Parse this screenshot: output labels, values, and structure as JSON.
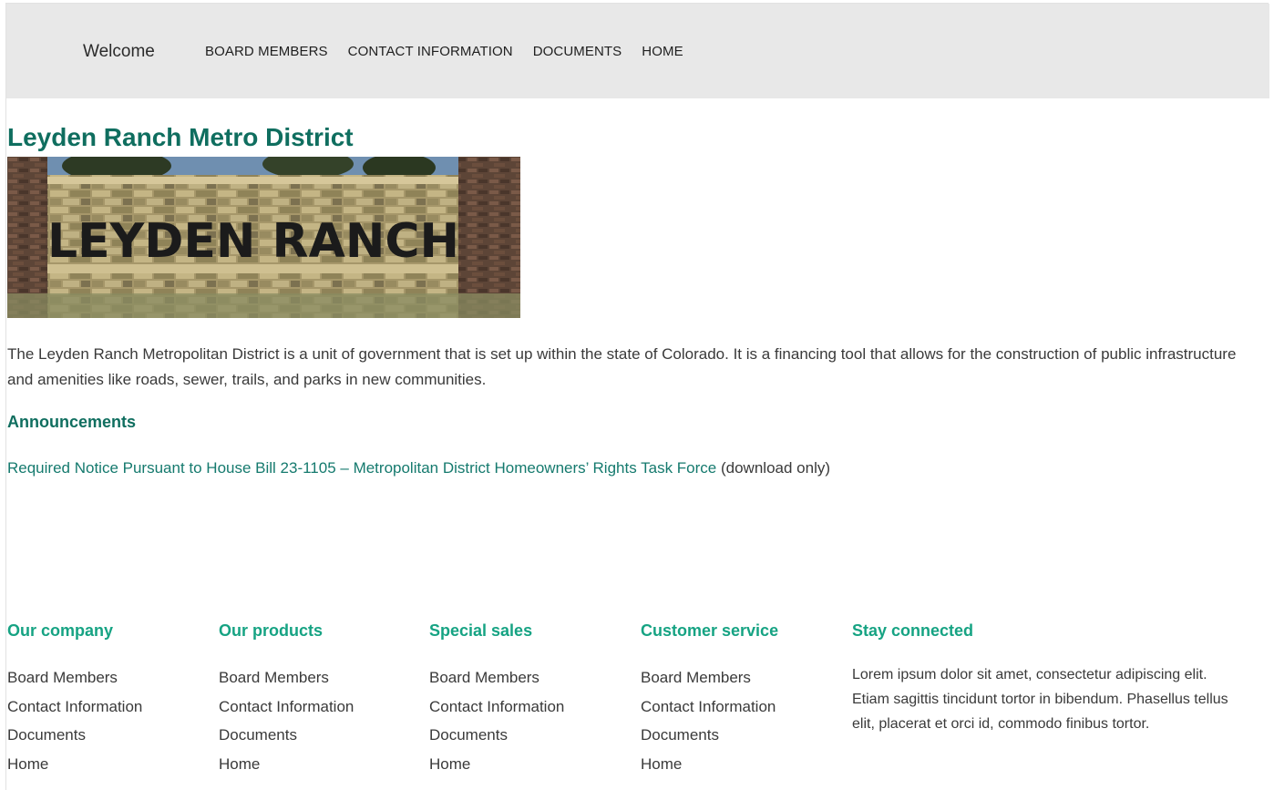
{
  "header": {
    "welcome": "Welcome",
    "nav": [
      "BOARD MEMBERS",
      "CONTACT INFORMATION",
      "DOCUMENTS",
      "HOME"
    ]
  },
  "main": {
    "title": "Leyden Ranch Metro District",
    "hero_sign_text": "LEYDEN RANCH",
    "intro": "The Leyden Ranch Metropolitan District is a unit of government that is set up within the state of Colorado. It is a financing tool that allows for the construction of public infrastructure and amenities like roads, sewer, trails, and parks in new communities.",
    "announcements_heading": "Announcements",
    "announcement_link": "Required Notice Pursuant to House Bill 23-1105 – Metropolitan District Homeowners’ Rights Task Force",
    "announcement_note": " (download only)"
  },
  "footer": {
    "columns": [
      {
        "heading": "Our company",
        "links": [
          "Board Members",
          "Contact Information",
          "Documents",
          "Home"
        ]
      },
      {
        "heading": "Our products",
        "links": [
          "Board Members",
          "Contact Information",
          "Documents",
          "Home"
        ]
      },
      {
        "heading": "Special sales",
        "links": [
          "Board Members",
          "Contact Information",
          "Documents",
          "Home"
        ]
      },
      {
        "heading": "Customer service",
        "links": [
          "Board Members",
          "Contact Information",
          "Documents",
          "Home"
        ]
      }
    ],
    "stay_connected": {
      "heading": "Stay connected",
      "text": "Lorem ipsum dolor sit amet, consectetur adipiscing elit. Etiam sagittis tincidunt tortor in bibendum. Phasellus tellus elit, placerat et orci id, commodo finibus tortor."
    }
  },
  "colors": {
    "header_bg": "#e8e8e8",
    "title_green": "#0f6e5f",
    "link_green": "#157a6e",
    "footer_heading_green": "#16a383"
  }
}
